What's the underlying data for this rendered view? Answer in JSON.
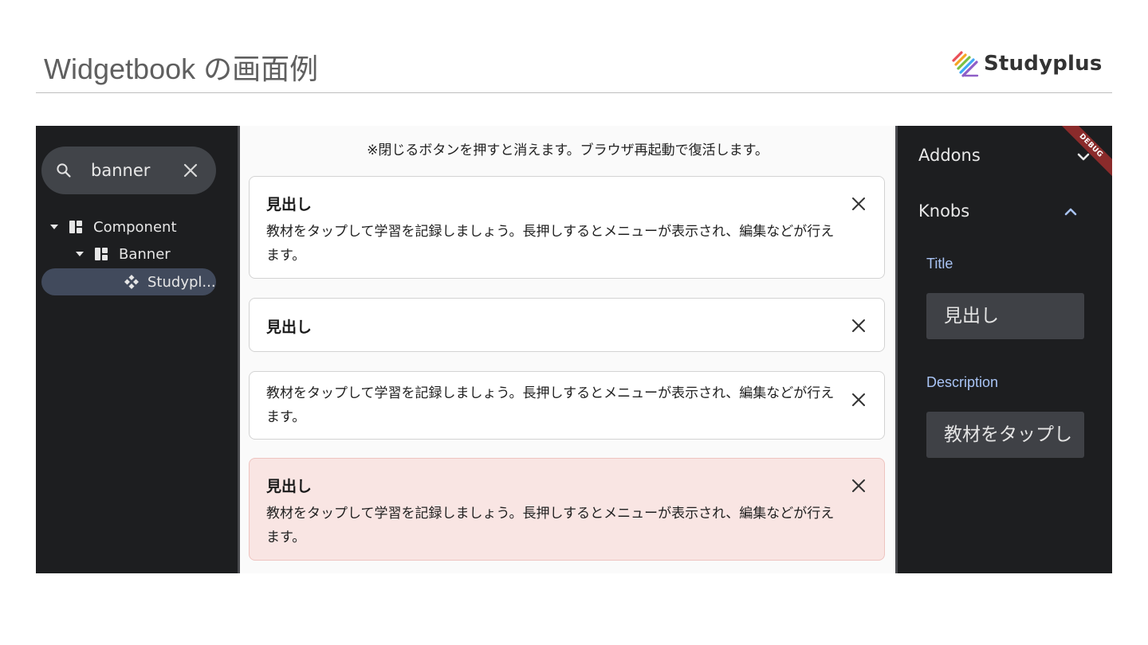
{
  "slide": {
    "title": "Widgetbook の画面例",
    "brand_name": "Studyplus",
    "brand_colors": [
      "#e94f58",
      "#f6a623",
      "#7ac143",
      "#3fa9f5",
      "#8e5ec7"
    ]
  },
  "sidebar": {
    "search": {
      "value": "banner",
      "search_icon": "search-icon",
      "clear_icon": "close-icon"
    },
    "tree": [
      {
        "label": "Component",
        "icon": "component-icon",
        "level": 0,
        "expanded": true
      },
      {
        "label": "Banner",
        "icon": "component-icon",
        "level": 1,
        "expanded": true
      },
      {
        "label": "Studypl...",
        "icon": "story-icon",
        "level": 2,
        "selected": true
      }
    ]
  },
  "main": {
    "notice": "※閉じるボタンを押すと消えます。ブラウザ再起動で復活します。",
    "banners": [
      {
        "title": "見出し",
        "description": "教材をタップして学習を記録しましょう。長押しするとメニューが表示され、編集などが行えます。",
        "variant": "default"
      },
      {
        "title": "見出し",
        "description": "",
        "variant": "default"
      },
      {
        "title": "",
        "description": "教材をタップして学習を記録しましょう。長押しするとメニューが表示され、編集などが行えます。",
        "variant": "default"
      },
      {
        "title": "見出し",
        "description": "教材をタップして学習を記録しましょう。長押しするとメニューが表示され、編集などが行えます。",
        "variant": "error"
      }
    ],
    "close_icon": "close-icon",
    "colors": {
      "banner_bg": "#ffffff",
      "error_bg": "#f9e5e3",
      "error_border": "#eec4c0"
    }
  },
  "right_panel": {
    "addons": {
      "label": "Addons",
      "expanded": false
    },
    "knobs": {
      "label": "Knobs",
      "expanded": true
    },
    "fields": [
      {
        "label": "Title",
        "value": "見出し"
      },
      {
        "label": "Description",
        "value": "教材をタップし"
      }
    ],
    "debug_badge": "DEBUG",
    "accent": "#a9c4f5"
  }
}
